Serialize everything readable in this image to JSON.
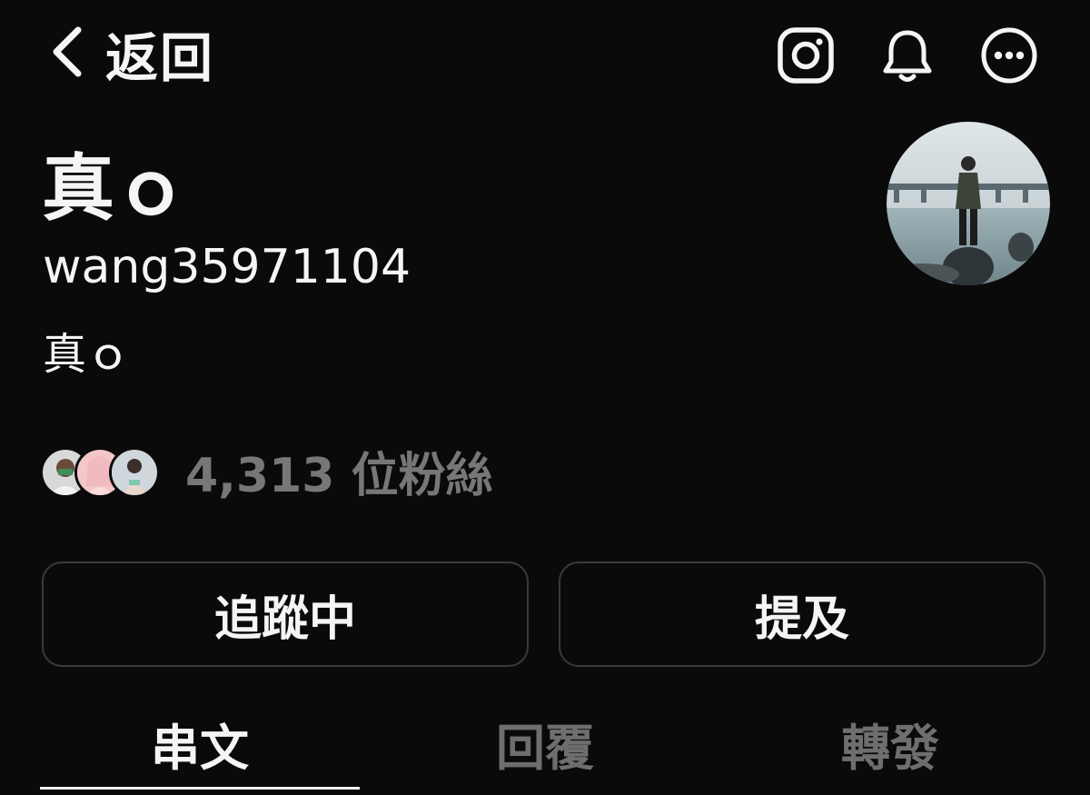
{
  "header": {
    "back_label": "返回",
    "icons": [
      "instagram-icon",
      "bell-icon",
      "more-options-icon"
    ]
  },
  "profile": {
    "display_name": "真ｏ",
    "username": "wang35971104",
    "bio": "真ｏ",
    "followers_text": "4,313 位粉絲"
  },
  "actions": {
    "following_label": "追蹤中",
    "mention_label": "提及"
  },
  "tabs": [
    {
      "label": "串文",
      "active": true
    },
    {
      "label": "回覆",
      "active": false
    },
    {
      "label": "轉發",
      "active": false
    }
  ],
  "colors": {
    "background": "#0a0a0a",
    "text": "#f5f5f5",
    "muted": "#6e6e6e",
    "border": "#3a3a3a"
  }
}
